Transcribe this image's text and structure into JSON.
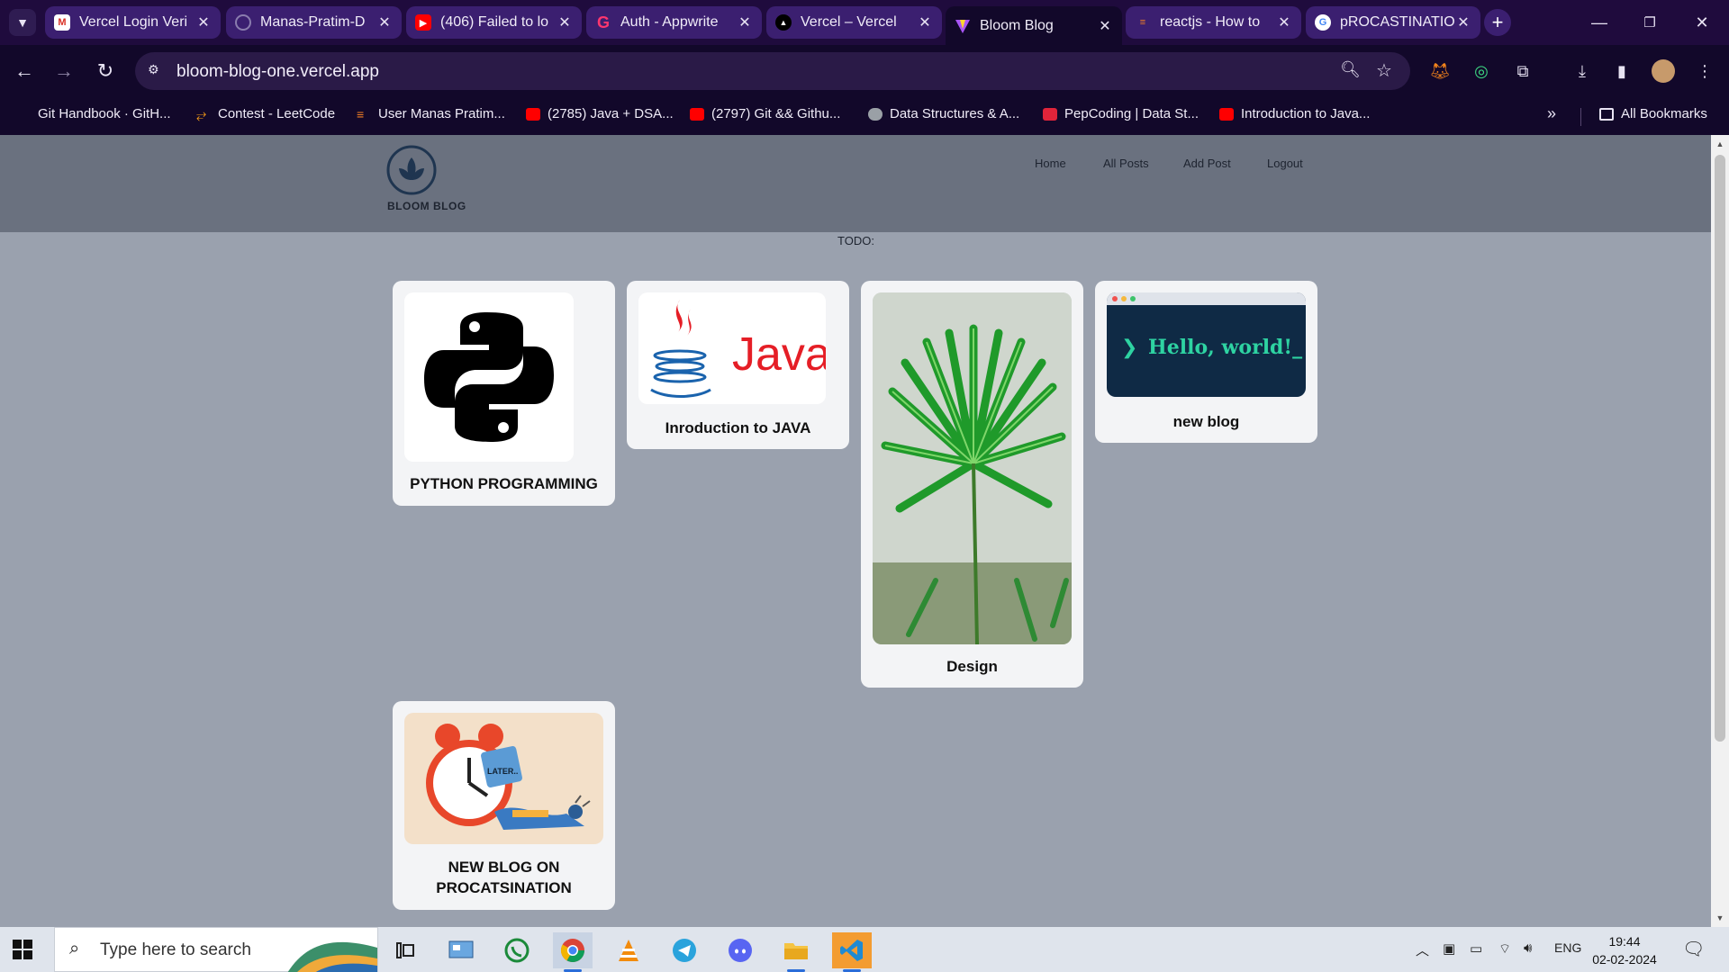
{
  "browser": {
    "tabs": [
      {
        "title": "Vercel Login Veri",
        "favicon": "gmail-icon",
        "color": "#d93025"
      },
      {
        "title": "Manas-Pratim-D",
        "favicon": "github-icon",
        "color": "#24292f"
      },
      {
        "title": "(406) Failed to lo",
        "favicon": "youtube-icon",
        "color": "#ff0000"
      },
      {
        "title": "Auth - Appwrite",
        "favicon": "appwrite-icon",
        "color": "#fd366e"
      },
      {
        "title": "Vercel – Vercel",
        "favicon": "vercel-icon",
        "color": "#000000"
      },
      {
        "title": "Bloom Blog",
        "favicon": "vite-icon",
        "color": "#a855f7",
        "active": true
      },
      {
        "title": "reactjs - How to",
        "favicon": "stackoverflow-icon",
        "color": "#f48024"
      },
      {
        "title": "pROCASTINATIO",
        "favicon": "google-icon",
        "color": "#4285f4"
      }
    ],
    "url": "bloom-blog-one.vercel.app",
    "bookmarks": [
      {
        "label": "Git Handbook · GitH...",
        "icon": "github-icon",
        "color": "#24292f"
      },
      {
        "label": "Contest - LeetCode",
        "icon": "leetcode-icon",
        "color": "#ffa116"
      },
      {
        "label": "User Manas Pratim...",
        "icon": "stackoverflow-icon",
        "color": "#f48024"
      },
      {
        "label": "(2785) Java + DSA...",
        "icon": "youtube-icon",
        "color": "#ff0000"
      },
      {
        "label": "(2797) Git && Githu...",
        "icon": "youtube-icon",
        "color": "#ff0000"
      },
      {
        "label": "Data Structures & A...",
        "icon": "globe-icon",
        "color": "#9aa0a6"
      },
      {
        "label": "PepCoding | Data St...",
        "icon": "pepcoding-icon",
        "color": "#e0243a"
      },
      {
        "label": "Introduction to Java...",
        "icon": "youtube-icon",
        "color": "#ff0000"
      }
    ],
    "all_bookmarks": "All Bookmarks"
  },
  "site": {
    "brand": "BLOOM BLOG",
    "nav": [
      "Home",
      "All Posts",
      "Add Post",
      "Logout"
    ],
    "todo": "TODO:",
    "posts": [
      {
        "title": "PYTHON PROGRAMMING",
        "image": "python-logo"
      },
      {
        "title": "Inroduction to JAVA",
        "image": "java-logo"
      },
      {
        "title": "Design",
        "image": "palm-leaf-photo"
      },
      {
        "title": "new blog",
        "image": "hello-world-terminal",
        "image_text": "Hello, world!_"
      },
      {
        "title_line1": "NEW BLOG ON",
        "title_line2": "PROCATSINATION",
        "image": "alarm-clock-illustration",
        "image_text": "LATER.."
      }
    ]
  },
  "taskbar": {
    "search_placeholder": "Type here to search",
    "tray": {
      "language": "ENG"
    },
    "time": "19:44",
    "date": "02-02-2024"
  },
  "colors": {
    "chrome_frame": "#1f0b3d",
    "chrome_toolbar": "#12082a",
    "site_header": "#6a717f",
    "page_bg": "#9aa1ae",
    "card_bg": "#f3f4f6"
  }
}
